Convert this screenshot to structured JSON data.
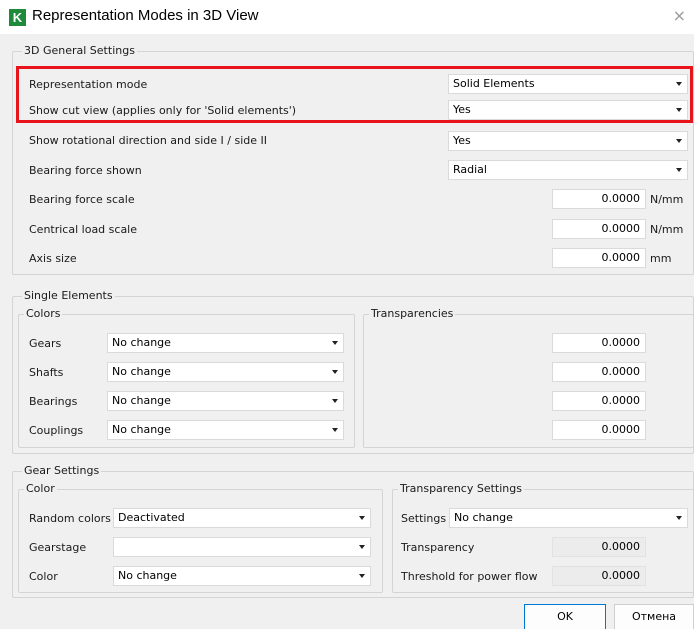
{
  "window": {
    "title": "Representation Modes in 3D View",
    "app_icon_letter": "K",
    "close_glyph": "×"
  },
  "general": {
    "group_label": "3D General Settings",
    "representation_mode": {
      "label": "Representation mode",
      "value": "Solid Elements"
    },
    "cut_view": {
      "label": "Show cut view (applies only for 'Solid elements')",
      "value": "Yes"
    },
    "rotational_direction": {
      "label": "Show rotational direction and side I / side II",
      "value": "Yes"
    },
    "bearing_force_shown": {
      "label": "Bearing force shown",
      "value": "Radial"
    },
    "bearing_force_scale": {
      "label": "Bearing force scale",
      "value": "0.0000",
      "unit": "N/mm"
    },
    "central_load_scale": {
      "label": "Centrical load scale",
      "value": "0.0000",
      "unit": "N/mm"
    },
    "axis_size": {
      "label": "Axis size",
      "value": "0.0000",
      "unit": "mm"
    }
  },
  "single_elements": {
    "group_label": "Single Elements",
    "colors_label": "Colors",
    "transparencies_label": "Transparencies",
    "rows": [
      {
        "label": "Gears",
        "color": "No change",
        "transparency": "0.0000"
      },
      {
        "label": "Shafts",
        "color": "No change",
        "transparency": "0.0000"
      },
      {
        "label": "Bearings",
        "color": "No change",
        "transparency": "0.0000"
      },
      {
        "label": "Couplings",
        "color": "No change",
        "transparency": "0.0000"
      }
    ]
  },
  "gear_settings": {
    "group_label": "Gear Settings",
    "color_group_label": "Color",
    "random_colors": {
      "label": "Random colors",
      "value": "Deactivated"
    },
    "gearstage": {
      "label": "Gearstage",
      "value": ""
    },
    "color": {
      "label": "Color",
      "value": "No change"
    },
    "transparency_group_label": "Transparency Settings",
    "settings": {
      "label": "Settings",
      "value": "No change"
    },
    "transparency": {
      "label": "Transparency",
      "value": "0.0000"
    },
    "threshold": {
      "label": "Threshold for power flow",
      "value": "0.0000"
    }
  },
  "buttons": {
    "ok": "OK",
    "cancel": "Отмена"
  },
  "colors": {
    "highlight": "#e8141c",
    "app_icon": "#1f8a3c",
    "default_button_border": "#0078d4"
  }
}
